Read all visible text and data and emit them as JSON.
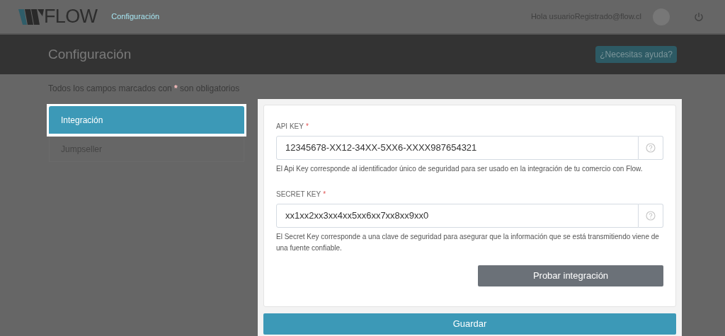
{
  "header": {
    "logo_text": "FLOW",
    "nav_link": "Configuración",
    "greeting": "Hola usuarioRegistrado@flow.cl"
  },
  "page_title": "Configuración",
  "help_button": "¿Necesitas ayuda?",
  "required_note": {
    "before": "Todos los campos marcados con",
    "mark": "*",
    "after": "son obligatorios"
  },
  "sidebar": {
    "items": [
      {
        "label": "Integración",
        "selected": true
      },
      {
        "label": "Jumpseller",
        "selected": false
      }
    ]
  },
  "fields": [
    {
      "label": "API KEY",
      "required": true,
      "value": "12345678-XX12-34XX-5XX6-XXXX987654321",
      "help": "El Api Key corresponde al identificador único de seguridad para ser usado en la integración de tu comercio con Flow."
    },
    {
      "label": "SECRET KEY",
      "required": true,
      "value": "xx1xx2xx3xx4xx5xx6xx7xx8xx9xx0",
      "help": "El Secret Key corresponde a una clave de seguridad para asegurar que la información que se está transmitiendo viene de una fuente confiable."
    }
  ],
  "required_mark": "*",
  "test_button": "Probar integración",
  "save_button": "Guardar"
}
